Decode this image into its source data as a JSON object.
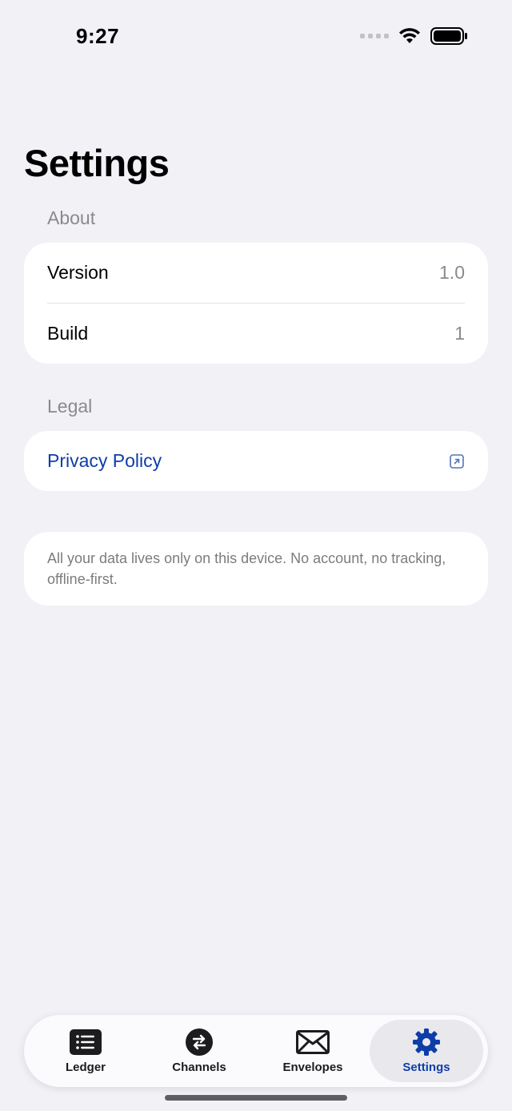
{
  "status_bar": {
    "time": "9:27"
  },
  "page": {
    "title": "Settings"
  },
  "about": {
    "header": "About",
    "rows": [
      {
        "label": "Version",
        "value": "1.0"
      },
      {
        "label": "Build",
        "value": "1"
      }
    ]
  },
  "legal": {
    "header": "Legal",
    "privacy_label": "Privacy Policy",
    "privacy_icon": "external-link-icon"
  },
  "footer": {
    "note": "All your data lives only on this device. No account, no tracking, offline-first."
  },
  "tabbar": {
    "tabs": [
      {
        "label": "Ledger",
        "icon": "list-icon"
      },
      {
        "label": "Channels",
        "icon": "swap-arrows-icon"
      },
      {
        "label": "Envelopes",
        "icon": "envelope-icon"
      },
      {
        "label": "Settings",
        "icon": "gear-icon"
      }
    ],
    "active_tab": "Settings"
  },
  "colors": {
    "accent": "#0d3ea8",
    "background": "#f1f1f6",
    "secondary_text": "#8a8a8e"
  }
}
